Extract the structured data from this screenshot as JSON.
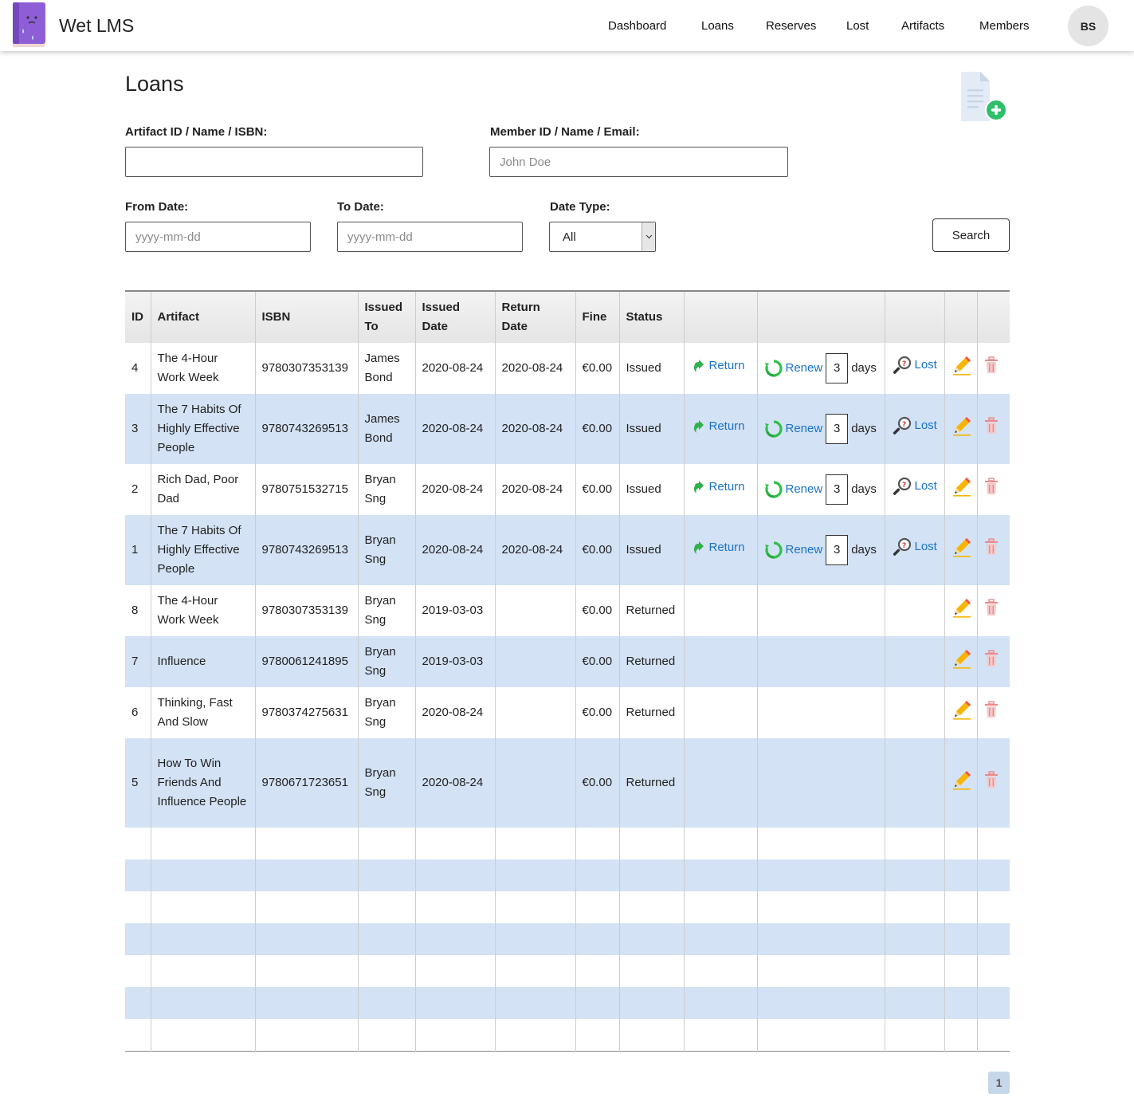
{
  "app": {
    "brand": "Wet LMS",
    "user_initials": "BS"
  },
  "nav": {
    "items": [
      "Dashboard",
      "Loans",
      "Reserves",
      "Lost",
      "Artifacts",
      "Members"
    ]
  },
  "page": {
    "title": "Loans"
  },
  "filters": {
    "artifact_label": "Artifact ID / Name / ISBN:",
    "artifact_placeholder": "",
    "member_label": "Member ID / Name / Email:",
    "member_placeholder": "John Doe",
    "from_label": "From Date:",
    "from_placeholder": "yyyy-mm-dd",
    "to_label": "To Date:",
    "to_placeholder": "yyyy-mm-dd",
    "date_type_label": "Date Type:",
    "date_type_value": "All",
    "search_label": "Search"
  },
  "table": {
    "headers": [
      "ID",
      "Artifact",
      "ISBN",
      "Issued To",
      "Issued Date",
      "Return Date",
      "Fine",
      "Status"
    ],
    "action_labels": {
      "return": "Return",
      "renew": "Renew",
      "days": "days",
      "lost": "Lost"
    },
    "rows": [
      {
        "id": "4",
        "artifact": "The 4-Hour Work Week",
        "isbn": "9780307353139",
        "issued_to": "James Bond",
        "issued_date": "2020-08-24",
        "return_date": "2020-08-24",
        "fine": "€0.00",
        "status": "Issued",
        "actions": true,
        "renew_days": "3"
      },
      {
        "id": "3",
        "artifact": "The 7 Habits Of Highly Effective People",
        "isbn": "9780743269513",
        "issued_to": "James Bond",
        "issued_date": "2020-08-24",
        "return_date": "2020-08-24",
        "fine": "€0.00",
        "status": "Issued",
        "actions": true,
        "renew_days": "3"
      },
      {
        "id": "2",
        "artifact": "Rich Dad, Poor Dad",
        "isbn": "9780751532715",
        "issued_to": "Bryan Sng",
        "issued_date": "2020-08-24",
        "return_date": "2020-08-24",
        "fine": "€0.00",
        "status": "Issued",
        "actions": true,
        "renew_days": "3"
      },
      {
        "id": "1",
        "artifact": "The 7 Habits Of Highly Effective People",
        "isbn": "9780743269513",
        "issued_to": "Bryan Sng",
        "issued_date": "2020-08-24",
        "return_date": "2020-08-24",
        "fine": "€0.00",
        "status": "Issued",
        "actions": true,
        "renew_days": "3"
      },
      {
        "id": "8",
        "artifact": "The 4-Hour Work Week",
        "isbn": "9780307353139",
        "issued_to": "Bryan Sng",
        "issued_date": "2019-03-03",
        "return_date": "",
        "fine": "€0.00",
        "status": "Returned",
        "actions": false
      },
      {
        "id": "7",
        "artifact": "Influence",
        "isbn": "9780061241895",
        "issued_to": "Bryan Sng",
        "issued_date": "2019-03-03",
        "return_date": "",
        "fine": "€0.00",
        "status": "Returned",
        "actions": false
      },
      {
        "id": "6",
        "artifact": "Thinking, Fast And Slow",
        "isbn": "9780374275631",
        "issued_to": "Bryan Sng",
        "issued_date": "2020-08-24",
        "return_date": "",
        "fine": "€0.00",
        "status": "Returned",
        "actions": false
      },
      {
        "id": "5",
        "artifact": "How To Win Friends And Influence People",
        "isbn": "9780671723651",
        "issued_to": "Bryan Sng",
        "issued_date": "2020-08-24",
        "return_date": "",
        "fine": "€0.00",
        "status": "Returned",
        "actions": false
      }
    ]
  },
  "pagination": {
    "current": "1"
  },
  "colors": {
    "accent": "#1a73c8",
    "row_alt": "#d3e2f4",
    "logo_purple": "#8e5ed6",
    "green": "#2ecc71"
  },
  "icons": {
    "logo": "book-logo-icon",
    "new_loan": "new-document-icon",
    "return": "return-arrow-icon",
    "renew": "renew-icon",
    "lost": "magnifier-icon",
    "edit": "pencil-icon",
    "delete": "trash-icon"
  }
}
